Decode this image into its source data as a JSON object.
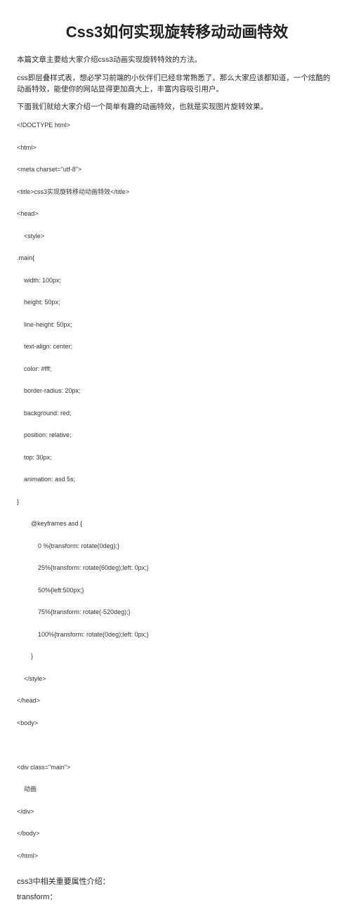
{
  "title": "Css3如何实现旋转移动动画特效",
  "para1": "本篇文章主要给大家介绍css3动画实现旋转特效的方法。",
  "para2": "css即层叠样式表，想必学习前端的小伙伴们已经非常熟悉了。那么大家应该都知道，一个炫酷的动画特效，能使你的网站显得更加高大上，丰富内容吸引用户。",
  "para3": "下面我们就给大家介绍一个简单有趣的动画特效，也就是实现图片旋转效果。",
  "code": "<!DOCTYPE html>\n\n<html>\n\n<meta charset=\"utf-8\">\n\n<title>css3实现旋转移动动画特效</title>\n\n<head>\n\n    <style>\n\n.main{\n\n    width: 100px;\n\n    height: 50px;\n\n    line-height: 50px;\n\n    text-align: center;\n\n    color: #fff;\n\n    border-radius: 20px;\n\n    background: red;\n\n    position: relative;\n\n    top: 30px;\n\n    animation: asd 5s;\n\n}\n\n        @keyframes asd {\n\n            0 %{transform: rotate(0deg);}\n\n            25%{transform: rotate(60deg);left: 0px;}\n\n            50%{left:500px;}\n\n            75%{transform: rotate(-520deg);}\n\n            100%{transform: rotate(0deg);left: 0px;}\n\n        }\n\n    </style>\n\n</head>\n\n<body>\n\n\n\n<div class=\"main\">\n\n    动画\n\n</div>\n\n</body>\n\n</html>",
  "sub": "css3中相关重要属性介绍：",
  "term": "transform："
}
